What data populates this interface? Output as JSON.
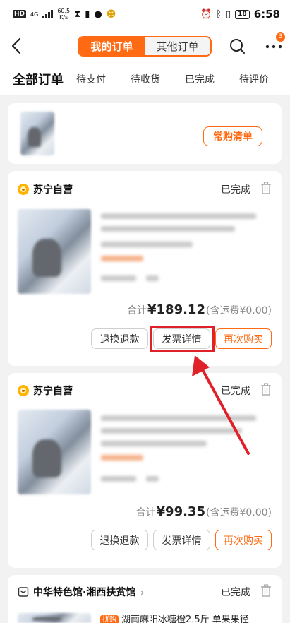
{
  "status_bar": {
    "network_tag": "HD",
    "signal_label": "4G",
    "speed_value": "60.5",
    "speed_unit": "K/s",
    "battery": "18",
    "time": "6:58"
  },
  "header": {
    "tabs": [
      {
        "label": "我的订单",
        "active": true
      },
      {
        "label": "其他订单",
        "active": false
      }
    ],
    "more_badge": "3"
  },
  "order_tabs": [
    {
      "label": "全部订单",
      "active": true
    },
    {
      "label": "待支付",
      "active": false
    },
    {
      "label": "待收货",
      "active": false
    },
    {
      "label": "已完成",
      "active": false
    },
    {
      "label": "待评价",
      "active": false
    }
  ],
  "frequent_card": {
    "button_label": "常购清单"
  },
  "orders": [
    {
      "store": "苏宁自营",
      "status": "已完成",
      "total_label": "合计",
      "total_amount": "¥189.12",
      "shipping_note": "(含运费¥0.00)",
      "actions": [
        "退换退款",
        "发票详情",
        "再次购买"
      ]
    },
    {
      "store": "苏宁自营",
      "status": "已完成",
      "total_label": "合计",
      "total_amount": "¥99.35",
      "shipping_note": "(含运费¥0.00)",
      "actions": [
        "退换退款",
        "发票详情",
        "再次购买"
      ]
    },
    {
      "store": "中华特色馆·湘西扶贫馆",
      "status": "已完成",
      "tag": "拼购",
      "product_title": "湖南麻阳冰糖橙2.5斤 单果果径"
    }
  ],
  "colors": {
    "accent": "#ff6a12",
    "highlight": "#e1212a",
    "background": "#f2f2f2"
  }
}
